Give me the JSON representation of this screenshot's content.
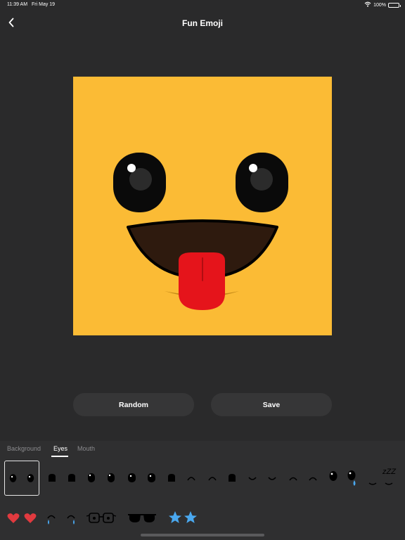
{
  "status_bar": {
    "time": "11:39 AM",
    "date": "Fri May 19",
    "battery": "100%"
  },
  "nav": {
    "title": "Fun Emoji"
  },
  "actions": {
    "random_label": "Random",
    "save_label": "Save"
  },
  "tabs": [
    {
      "label": "Background",
      "active": false
    },
    {
      "label": "Eyes",
      "active": true
    },
    {
      "label": "Mouth",
      "active": false
    }
  ],
  "colors": {
    "face": "#fbbb35",
    "eye": "#0a0a0a",
    "mouth": "#2e1a0e",
    "tongue": "#e5141b",
    "background": "#2a2a2b"
  },
  "eye_options": [
    "round-eyes",
    "square-eyes",
    "round-eyes-2",
    "round-eyes-3",
    "square-eyes-2",
    "arc-eyes-up",
    "arc-square-eyes",
    "smile-eyes",
    "smile-eyes-2",
    "arc-eyes-down",
    "single-eye",
    "tear-eye",
    "sleepy-zzz-eyes",
    "heart-eyes",
    "crying-eyes",
    "glasses-eyes",
    "sunglasses-eyes",
    "star-eyes"
  ],
  "selected_eye_option": "round-eyes",
  "sleepy_text": "zZZ"
}
